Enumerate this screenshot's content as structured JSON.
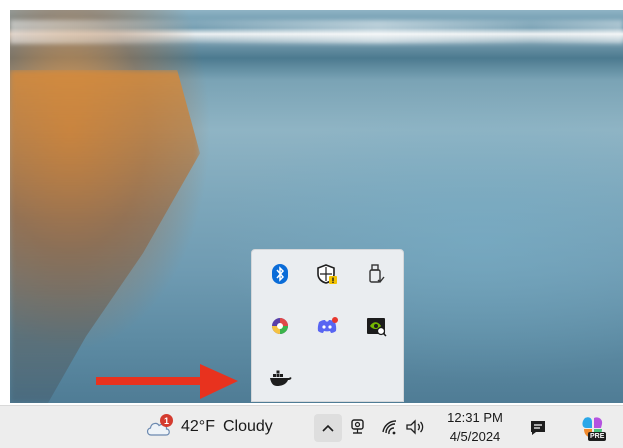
{
  "tray": {
    "icons": [
      "bluetooth-icon",
      "windows-security-icon",
      "usb-eject-icon",
      "color-picker-app-icon",
      "discord-icon",
      "nvidia-icon",
      "docker-icon"
    ]
  },
  "taskbar": {
    "weather": {
      "badge": "1",
      "temperature": "42°F",
      "condition": "Cloudy"
    },
    "clock": {
      "time": "12:31 PM",
      "date": "4/5/2024"
    },
    "copilot_badge": "PRE"
  },
  "colors": {
    "arrow": "#e8321e",
    "bluetooth": "#0a6cd8",
    "notification_badge": "#d43b2f"
  }
}
